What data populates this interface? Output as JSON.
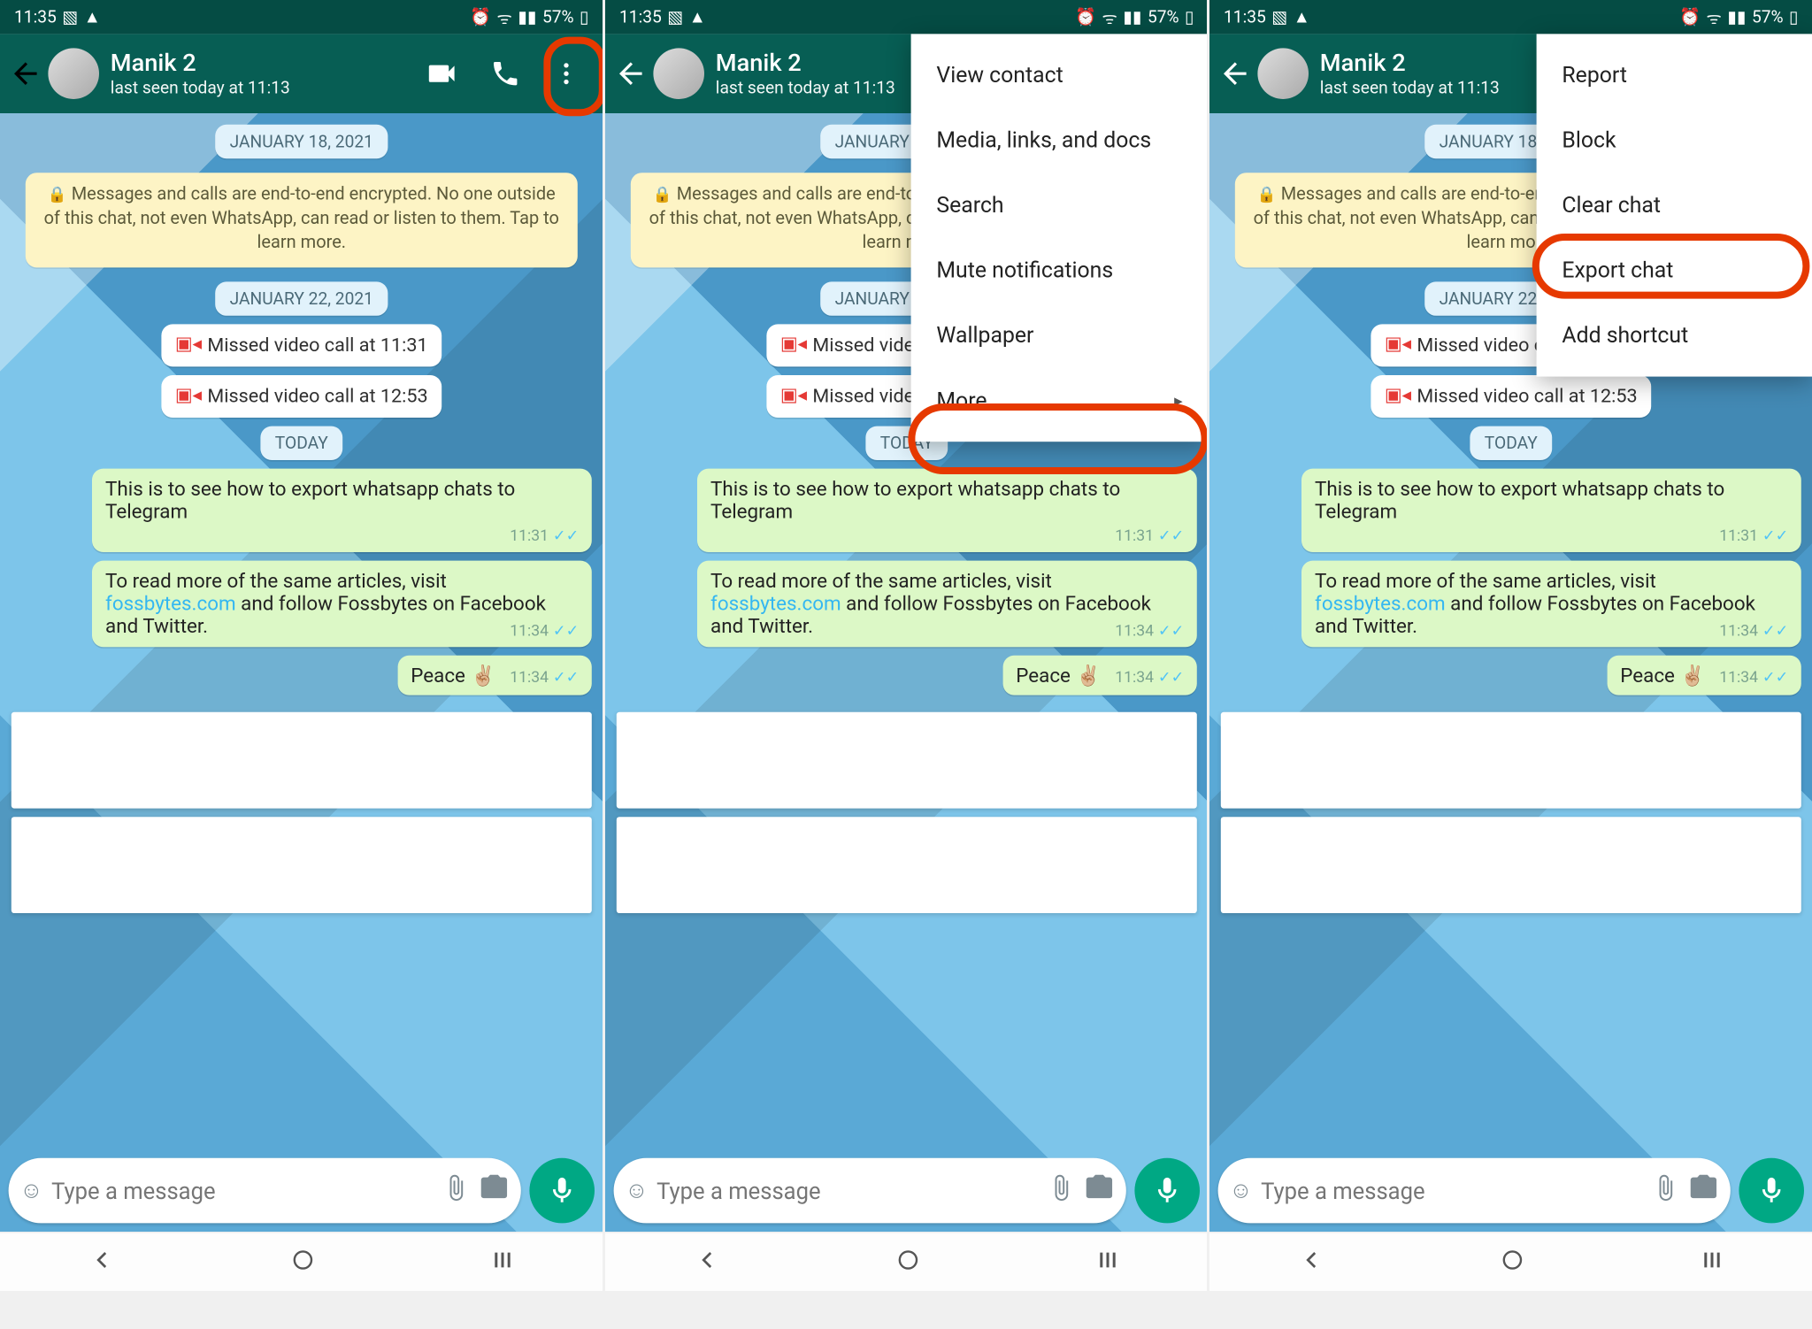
{
  "status": {
    "time": "11:35",
    "battery": "57%"
  },
  "header": {
    "contact_name": "Manik 2",
    "last_seen": "last seen today at 11:13"
  },
  "chat": {
    "date1": "JANUARY 18, 2021",
    "encryption": "Messages and calls are end-to-end encrypted. No one outside of this chat, not even WhatsApp, can read or listen to them. Tap to learn more.",
    "date2": "JANUARY 22, 2021",
    "missed1": "Missed video call at 11:31",
    "missed2": "Missed video call at 12:53",
    "date3": "TODAY",
    "msg1": {
      "text": "This is to see how to export whatsapp chats to Telegram",
      "time": "11:31"
    },
    "msg2": {
      "pre": "To read more of the same articles, visit ",
      "link": "fossbytes.com",
      "post": " and follow Fossbytes on Facebook and Twitter.",
      "time": "11:34"
    },
    "msg3": {
      "text": "Peace",
      "emoji": "✌🏼",
      "time": "11:34"
    }
  },
  "input": {
    "placeholder": "Type a message"
  },
  "menu1": {
    "items": [
      "View contact",
      "Media, links, and docs",
      "Search",
      "Mute notifications",
      "Wallpaper",
      "More"
    ]
  },
  "menu2": {
    "items": [
      "Report",
      "Block",
      "Clear chat",
      "Export chat",
      "Add shortcut"
    ]
  }
}
